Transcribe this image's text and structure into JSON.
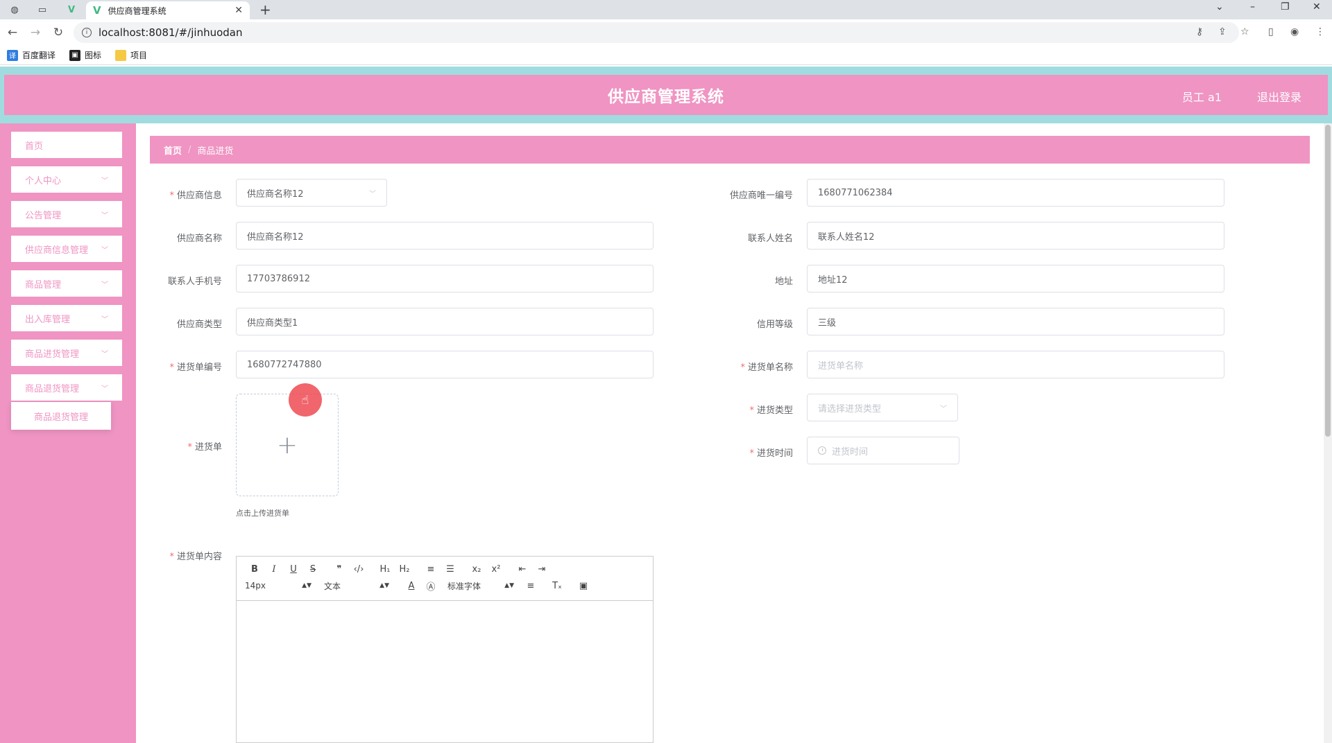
{
  "browser": {
    "tab_title": "供应商管理系统",
    "url": "localhost:8081/#/jinhuodan",
    "bookmarks": [
      "百度翻译",
      "图标",
      "项目"
    ]
  },
  "header": {
    "title": "供应商管理系统",
    "user": "员工 a1",
    "logout": "退出登录"
  },
  "sidebar": {
    "items": [
      {
        "label": "首页",
        "has_children": false
      },
      {
        "label": "个人中心",
        "has_children": true
      },
      {
        "label": "公告管理",
        "has_children": true
      },
      {
        "label": "供应商信息管理",
        "has_children": true
      },
      {
        "label": "商品管理",
        "has_children": true
      },
      {
        "label": "出入库管理",
        "has_children": true
      },
      {
        "label": "商品进货管理",
        "has_children": true
      },
      {
        "label": "商品退货管理",
        "has_children": true
      }
    ],
    "submenu_label": "商品退货管理"
  },
  "breadcrumb": {
    "home": "首页",
    "sep": "/",
    "current": "商品进货"
  },
  "form": {
    "supplier_info": {
      "label": "供应商信息",
      "value": "供应商名称12"
    },
    "supplier_code": {
      "label": "供应商唯一编号",
      "value": "1680771062384"
    },
    "supplier_name": {
      "label": "供应商名称",
      "value": "供应商名称12"
    },
    "contact_name": {
      "label": "联系人姓名",
      "value": "联系人姓名12"
    },
    "contact_phone": {
      "label": "联系人手机号",
      "value": "17703786912"
    },
    "address": {
      "label": "地址",
      "value": "地址12"
    },
    "supplier_type": {
      "label": "供应商类型",
      "value": "供应商类型1"
    },
    "credit_level": {
      "label": "信用等级",
      "value": "三级"
    },
    "order_no": {
      "label": "进货单编号",
      "value": "1680772747880"
    },
    "order_name": {
      "label": "进货单名称",
      "placeholder": "进货单名称"
    },
    "order_type": {
      "label": "进货类型",
      "placeholder": "请选择进货类型"
    },
    "order_time": {
      "label": "进货时间",
      "placeholder": "进货时间"
    },
    "order_file": {
      "label": "进货单",
      "tip": "点击上传进货单"
    },
    "order_content": {
      "label": "进货单内容"
    }
  },
  "editor": {
    "font_size": "14px",
    "block_type": "文本",
    "font_family": "标准字体",
    "row1": [
      "B",
      "I",
      "U",
      "S",
      "❞",
      "‹/›",
      "H₁",
      "H₂",
      "≡",
      "☰",
      "x₂",
      "x²",
      "⇤",
      "⇥"
    ],
    "row2_icons": [
      "A",
      "Ⓐ",
      "≡",
      "Tₓ",
      "▣"
    ]
  },
  "colors": {
    "primary_pink": "#ef94c3",
    "header_border": "#a0dcdf",
    "required": "#f56c6c"
  }
}
